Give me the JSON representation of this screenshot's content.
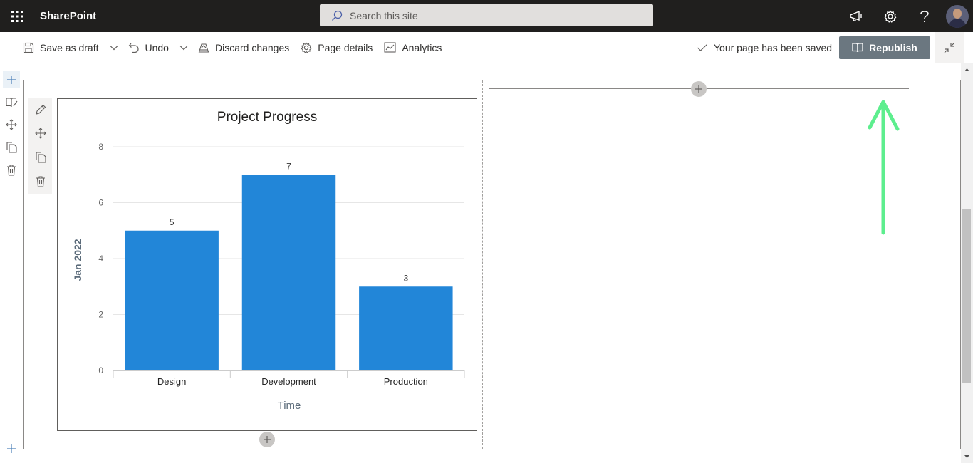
{
  "suitebar": {
    "brand": "SharePoint",
    "search_placeholder": "Search this site",
    "icons": [
      "app-launcher-icon",
      "megaphone-icon",
      "gear-icon",
      "help-icon",
      "avatar"
    ]
  },
  "commandbar": {
    "save_draft": "Save as draft",
    "undo": "Undo",
    "discard": "Discard changes",
    "page_details": "Page details",
    "analytics": "Analytics",
    "saved_status": "Your page has been saved",
    "republish": "Republish"
  },
  "colors": {
    "bar": "#2286d8",
    "republish_bg": "#6b7780",
    "annotation": "#5dee8e"
  },
  "chart_data": {
    "type": "bar",
    "title": "Project Progress",
    "categories": [
      "Design",
      "Development",
      "Production"
    ],
    "values": [
      5,
      7,
      3
    ],
    "xlabel": "Time",
    "ylabel": "Jan 2022",
    "ylim": [
      0,
      8
    ],
    "yticks": [
      0,
      2,
      4,
      6,
      8
    ],
    "grid": true,
    "legend": "none"
  }
}
